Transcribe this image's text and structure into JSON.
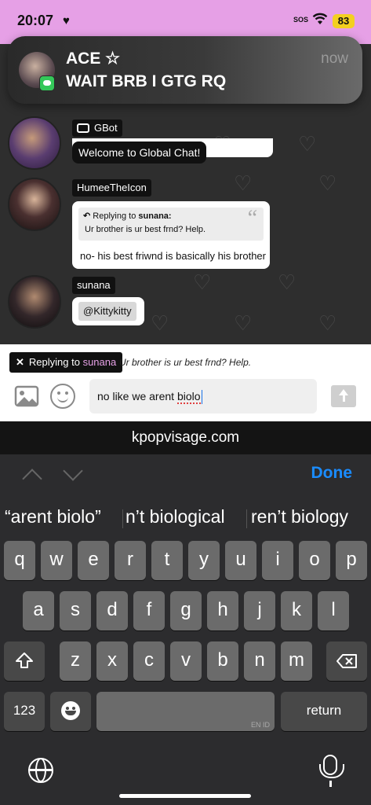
{
  "status": {
    "time": "20:07",
    "heart": "♥",
    "sos": "SOS",
    "battery": "83"
  },
  "notification": {
    "title": "ACE ☆",
    "body": "WAIT BRB I GTG RQ",
    "time": "now",
    "app_icon": "messages-icon"
  },
  "messages": [
    {
      "user": "GBot",
      "text": "Welcome to Global Chat!",
      "bot": true
    },
    {
      "user": "HumeeTheIcon",
      "reply_prefix": "Replying to",
      "reply_to": "sunana:",
      "reply_text": "Ur brother is ur best frnd? Help.",
      "text": "no- his best friwnd is basically his brother"
    },
    {
      "user": "sunana",
      "text": "@Kittykitty"
    }
  ],
  "compose": {
    "reply_label": "Replying to",
    "reply_user": "sunana",
    "reply_preview": "Ur brother is ur best frnd? Help.",
    "input_prefix": "no like we arent ",
    "input_misspelled": "biolo"
  },
  "browser": {
    "url": "kpopvisage.com"
  },
  "keyboard": {
    "done_label": "Done",
    "suggestions": [
      "“arent biolo”",
      "n’t biological",
      "ren’t biology"
    ],
    "row1": [
      "q",
      "w",
      "e",
      "r",
      "t",
      "y",
      "u",
      "i",
      "o",
      "p"
    ],
    "row2": [
      "a",
      "s",
      "d",
      "f",
      "g",
      "h",
      "j",
      "k",
      "l"
    ],
    "row3": [
      "z",
      "x",
      "c",
      "v",
      "b",
      "n",
      "m"
    ],
    "numbers_label": "123",
    "return_label": "return",
    "space_hint": "EN ID"
  },
  "colors": {
    "accent_pink": "#e6a0e6",
    "done_blue": "#1a8cff",
    "chat_bg": "#2e2e2e"
  }
}
